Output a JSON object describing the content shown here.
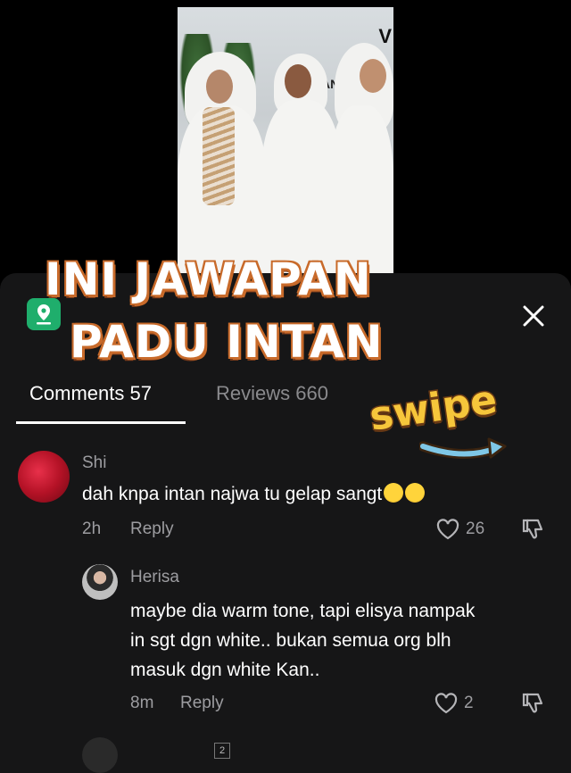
{
  "overlay": {
    "headline_line1": "INI JAWAPAN",
    "headline_line2": "PADU INTAN",
    "swipe_label": "swipe"
  },
  "photo": {
    "backdrop_text": "NGAN",
    "backdrop_text_top": "V"
  },
  "tabs": [
    {
      "label": "Comments 57",
      "active": true
    },
    {
      "label": "Reviews 660",
      "active": false
    }
  ],
  "comments": [
    {
      "username": "Shi",
      "text": "dah knpa intan najwa tu gelap sangt",
      "time": "2h",
      "reply_label": "Reply",
      "likes": "26"
    },
    {
      "username": "Herisa",
      "text_lines": [
        "maybe dia warm tone, tapi elisya nampak",
        "in sgt dgn white.. bukan semua org blh",
        "masuk dgn white Kan.."
      ],
      "time": "8m",
      "reply_label": "Reply",
      "likes": "2"
    }
  ],
  "page_indicator": "2",
  "icons": {
    "close": "close-icon",
    "like": "heart-icon",
    "dislike": "thumbs-down-icon",
    "app": "map-pin-icon"
  },
  "colors": {
    "sheet_bg": "#161617",
    "headline_outline": "#7a3b1a",
    "swipe_yellow": "#f6c63b",
    "app_green": "#1fae6c"
  }
}
